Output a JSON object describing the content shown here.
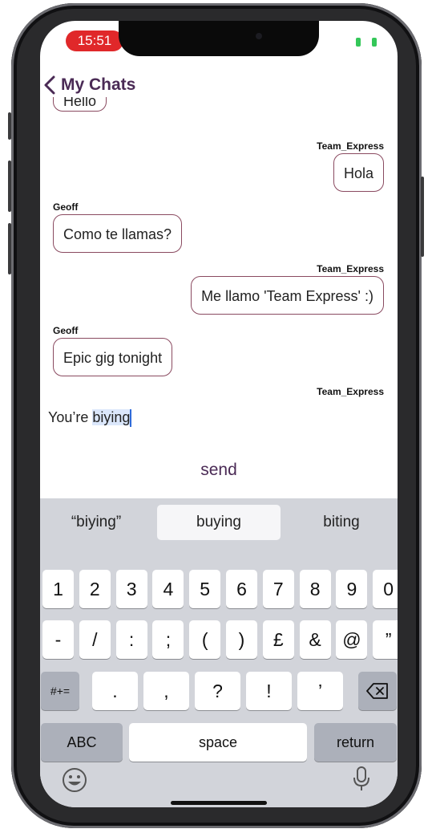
{
  "status_bar": {
    "time": "15:51"
  },
  "header": {
    "back_label": "My Chats"
  },
  "messages": [
    {
      "sender": "",
      "text": "Hello",
      "side": "left"
    },
    {
      "sender": "Team_Express",
      "text": "Hola",
      "side": "right"
    },
    {
      "sender": "Geoff",
      "text": "Como te llamas?",
      "side": "left"
    },
    {
      "sender": "Team_Express",
      "text": "Me llamo 'Team Express' :)",
      "side": "right"
    },
    {
      "sender": "Geoff",
      "text": "Epic gig tonight",
      "side": "left"
    },
    {
      "sender": "Team_Express",
      "text": "",
      "side": "right"
    }
  ],
  "composer": {
    "text_before": "You’re ",
    "text_selected": "biying",
    "send_label": "send"
  },
  "keyboard": {
    "suggestions": [
      "“biying”",
      "buying",
      "biting"
    ],
    "row1": [
      "1",
      "2",
      "3",
      "4",
      "5",
      "6",
      "7",
      "8",
      "9",
      "0"
    ],
    "row2": [
      "-",
      "/",
      ":",
      ";",
      "(",
      ")",
      "£",
      "&",
      "@",
      "”"
    ],
    "row3": [
      ".",
      ",",
      "?",
      "!",
      "’"
    ],
    "symbols_label": "#+=",
    "abc_label": "ABC",
    "space_label": "space",
    "return_label": "return"
  },
  "icons": {
    "back": "chevron-left-icon",
    "backspace": "backspace-icon",
    "emoji": "emoji-icon",
    "mic": "microphone-icon",
    "battery": "battery-icon"
  },
  "colors": {
    "accent": "#4a2a55",
    "bubble_border": "#8a4a60",
    "time_pill": "#e0282a"
  }
}
